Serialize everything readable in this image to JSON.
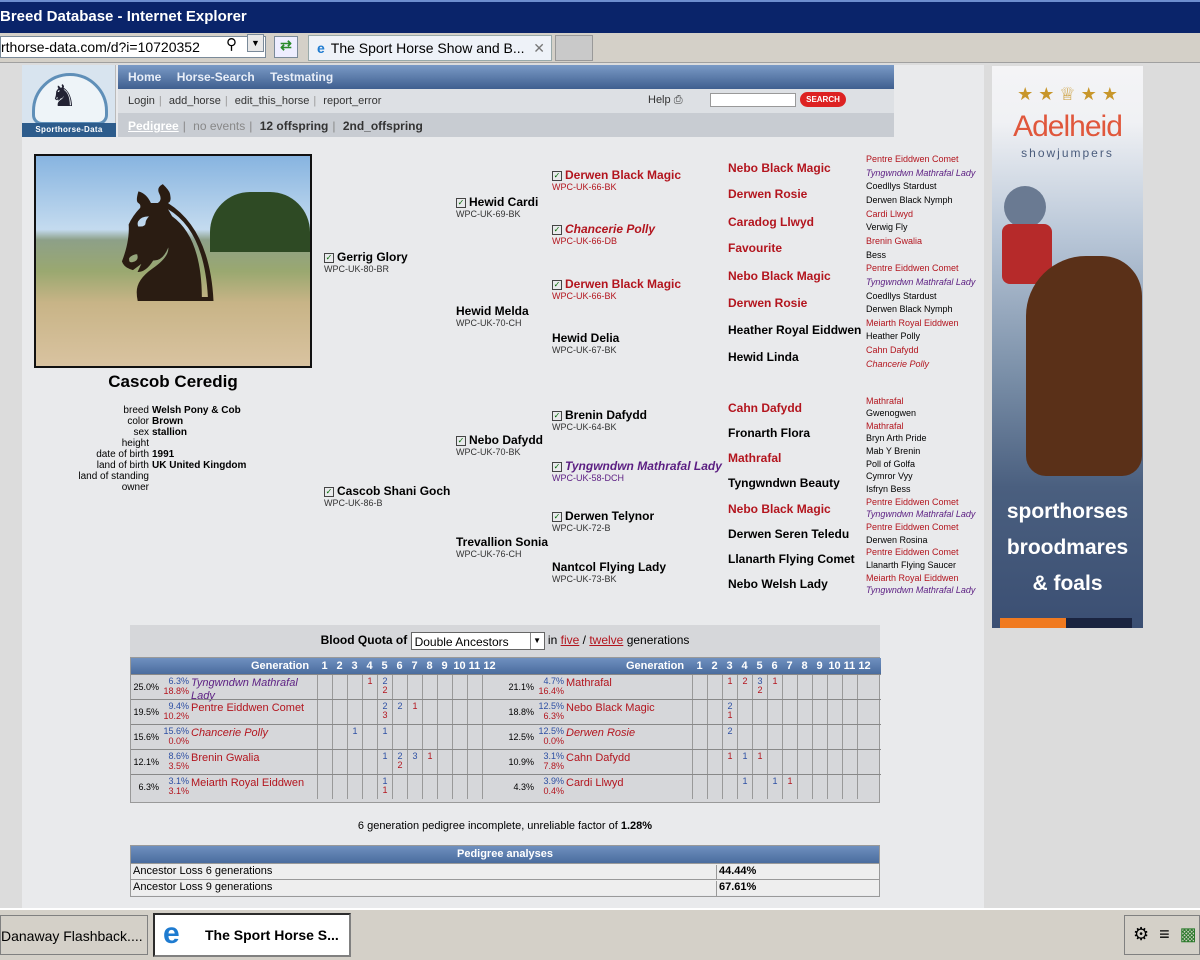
{
  "window": {
    "title": "Breed Database - Internet Explorer"
  },
  "browser": {
    "url": "rthorse-data.com/d?i=10720352",
    "tab_title": "The Sport Horse Show and B..."
  },
  "site": {
    "logo_text": "Sporthorse-Data",
    "nav1": [
      "Home",
      "Horse-Search",
      "Testmating"
    ],
    "nav2": [
      "Login",
      "add_horse",
      "edit_this_horse",
      "report_error"
    ],
    "help": "Help",
    "search_btn": "SEARCH",
    "nav3": {
      "pedigree": "Pedigree",
      "events": "no events",
      "offspring": "12 offspring",
      "offspring2": "2nd_offspring"
    }
  },
  "horse": {
    "name": "Cascob Ceredig",
    "details": [
      {
        "k": "breed",
        "v": "Welsh Pony & Cob"
      },
      {
        "k": "color",
        "v": "Brown"
      },
      {
        "k": "sex",
        "v": "stallion"
      },
      {
        "k": "height",
        "v": ""
      },
      {
        "k": "date of birth",
        "v": "1991"
      },
      {
        "k": "land of birth",
        "v": "UK United Kingdom"
      },
      {
        "k": "land of standing",
        "v": ""
      },
      {
        "k": "owner",
        "v": ""
      }
    ]
  },
  "pedigree": {
    "g1": [
      {
        "n": "Gerrig Glory",
        "c": "WPC-UK-80-BR"
      },
      {
        "n": "Cascob Shani Goch",
        "c": "WPC-UK-86-B"
      }
    ],
    "g2": [
      {
        "n": "Hewid Cardi",
        "c": "WPC-UK-69-BK"
      },
      {
        "n": "Hewid Melda",
        "c": "WPC-UK-70-CH"
      },
      {
        "n": "Nebo Dafydd",
        "c": "WPC-UK-70-BK"
      },
      {
        "n": "Trevallion Sonia",
        "c": "WPC-UK-76-CH"
      }
    ],
    "g3": [
      {
        "n": "Derwen Black Magic",
        "c": "WPC-UK-66-BK"
      },
      {
        "n": "Chancerie Polly",
        "c": "WPC-UK-66-DB"
      },
      {
        "n": "Derwen Black Magic",
        "c": "WPC-UK-66-BK"
      },
      {
        "n": "Hewid Delia",
        "c": "WPC-UK-67-BK"
      },
      {
        "n": "Brenin Dafydd",
        "c": "WPC-UK-64-BK"
      },
      {
        "n": "Tyngwndwn Mathrafal Lady",
        "c": "WPC-UK-58-DCH"
      },
      {
        "n": "Derwen Telynor",
        "c": "WPC-UK-72-B"
      },
      {
        "n": "Nantcol Flying Lady",
        "c": "WPC-UK-73-BK"
      }
    ],
    "g4": [
      "Nebo Black Magic",
      "Derwen Rosie",
      "Caradog Llwyd",
      "Favourite",
      "Nebo Black Magic",
      "Derwen Rosie",
      "Heather Royal Eiddwen",
      "Hewid Linda",
      "Cahn Dafydd",
      "Fronarth Flora",
      "Mathrafal",
      "Tyngwndwn Beauty",
      "Nebo Black Magic",
      "Derwen Seren Teledu",
      "Llanarth Flying Comet",
      "Nebo Welsh Lady"
    ],
    "g5": [
      "Pentre Eiddwen Comet",
      "Tyngwndwn Mathrafal Lady",
      "Coedllys Stardust",
      "Derwen Black Nymph",
      "Cardi Llwyd",
      "Verwig Fly",
      "Brenin Gwalia",
      "Bess",
      "Pentre Eiddwen Comet",
      "Tyngwndwn Mathrafal Lady",
      "Coedllys Stardust",
      "Derwen Black Nymph",
      "Meiarth Royal Eiddwen",
      "Heather Polly",
      "Cahn Dafydd",
      "Chancerie Polly",
      "Mathrafal",
      "Gwenogwen",
      "Mathrafal",
      "Bryn Arth Pride",
      "Mab Y Brenin",
      "Poll of Golfa",
      "Cymror Vyy",
      "Isfryn Bess",
      "Pentre Eiddwen Comet",
      "Tyngwndwn Mathrafal Lady",
      "Pentre Eiddwen Comet",
      "Derwen Rosina",
      "Pentre Eiddwen Comet",
      "Llanarth Flying Saucer",
      "Meiarth Royal Eiddwen",
      "Tyngwndwn Mathrafal Lady"
    ]
  },
  "blood_quota": {
    "label": "Blood Quota of",
    "select": "Double Ancestors",
    "in": "in",
    "five": "five",
    "slash": "/",
    "twelve": "twelve",
    "generations": "generations",
    "generation_label": "Generation",
    "gen_numbers": [
      "1",
      "2",
      "3",
      "4",
      "5",
      "6",
      "7",
      "8",
      "9",
      "10",
      "11",
      "12"
    ],
    "left": [
      {
        "p1": "25.0%",
        "p2a": "6.3%",
        "p2b": "18.8%",
        "name": "Tyngwndwn Mathrafal Lady",
        "cells": {
          "3": [
            "",
            "1"
          ],
          "4": [
            "2",
            "2"
          ]
        }
      },
      {
        "p1": "19.5%",
        "p2a": "9.4%",
        "p2b": "10.2%",
        "name": "Pentre Eiddwen Comet",
        "cells": {
          "4": [
            "2",
            "3"
          ],
          "5": [
            "2",
            ""
          ],
          "6": [
            "",
            "1"
          ]
        }
      },
      {
        "p1": "15.6%",
        "p2a": "15.6%",
        "p2b": "0.0%",
        "name": "Chancerie Polly",
        "cells": {
          "2": [
            "1",
            ""
          ],
          "4": [
            "1",
            ""
          ]
        }
      },
      {
        "p1": "12.1%",
        "p2a": "8.6%",
        "p2b": "3.5%",
        "name": "Brenin Gwalia",
        "cells": {
          "4": [
            "1",
            ""
          ],
          "5": [
            "2",
            "2"
          ],
          "6": [
            "3",
            ""
          ],
          "7": [
            "",
            "1"
          ]
        }
      },
      {
        "p1": "6.3%",
        "p2a": "3.1%",
        "p2b": "3.1%",
        "name": "Meiarth Royal Eiddwen",
        "cells": {
          "4": [
            "1",
            "1"
          ]
        }
      }
    ],
    "right": [
      {
        "p1": "21.1%",
        "p2a": "4.7%",
        "p2b": "16.4%",
        "name": "Mathrafal",
        "cells": {
          "2": [
            "",
            "1"
          ],
          "3": [
            "",
            "2"
          ],
          "4": [
            "3",
            "2"
          ],
          "5": [
            "",
            "1"
          ]
        }
      },
      {
        "p1": "18.8%",
        "p2a": "12.5%",
        "p2b": "6.3%",
        "name": "Nebo Black Magic",
        "cells": {
          "2": [
            "2",
            "1"
          ]
        }
      },
      {
        "p1": "12.5%",
        "p2a": "12.5%",
        "p2b": "0.0%",
        "name": "Derwen Rosie",
        "cells": {
          "2": [
            "2",
            ""
          ]
        }
      },
      {
        "p1": "10.9%",
        "p2a": "3.1%",
        "p2b": "7.8%",
        "name": "Cahn Dafydd",
        "cells": {
          "2": [
            "",
            "1"
          ],
          "3": [
            "1",
            ""
          ],
          "4": [
            "",
            "1"
          ]
        }
      },
      {
        "p1": "4.3%",
        "p2a": "3.9%",
        "p2b": "0.4%",
        "name": "Cardi Llwyd",
        "cells": {
          "3": [
            "1",
            ""
          ],
          "5": [
            "1",
            ""
          ],
          "6": [
            "",
            "1"
          ]
        }
      }
    ]
  },
  "incomplete": {
    "text": "6 generation pedigree incomplete, unreliable factor of",
    "value": "1.28%"
  },
  "analyses": {
    "title": "Pedigree analyses",
    "rows": [
      {
        "k": "Ancestor Loss 6 generations",
        "v": "44.44%"
      },
      {
        "k": "Ancestor Loss 9 generations",
        "v": "67.61%"
      }
    ]
  },
  "ad": {
    "brand": "Adelheid",
    "sub": "showjumpers",
    "slogan": [
      "sporthorses",
      "broodmares",
      "& foals"
    ]
  },
  "taskbar": {
    "item1": "Danaway Flashback....",
    "item2": "The Sport Horse S..."
  }
}
